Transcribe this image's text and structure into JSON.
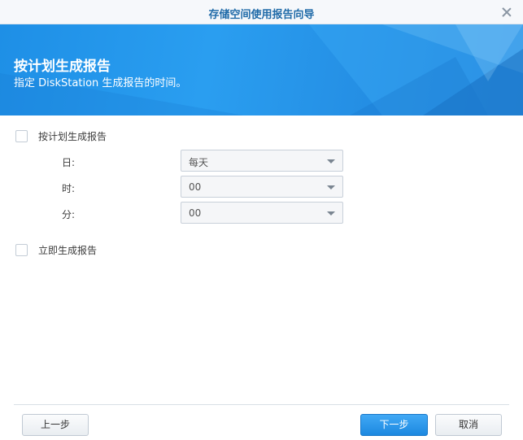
{
  "window": {
    "title": "存储空间使用报告向导",
    "close_icon": "close-icon"
  },
  "banner": {
    "title": "按计划生成报告",
    "subtitle": "指定 DiskStation 生成报告的时间。",
    "background_color": "#1e8fe6"
  },
  "options": {
    "schedule_label": "按计划生成报告",
    "schedule_checked": false,
    "now_label": "立即生成报告",
    "now_checked": false
  },
  "schedule": {
    "day_label": "日:",
    "day_value": "每天",
    "hour_label": "时:",
    "hour_value": "00",
    "minute_label": "分:",
    "minute_value": "00"
  },
  "footer": {
    "back_label": "上一步",
    "next_label": "下一步",
    "cancel_label": "取消",
    "primary_color": "#1c88e0"
  }
}
